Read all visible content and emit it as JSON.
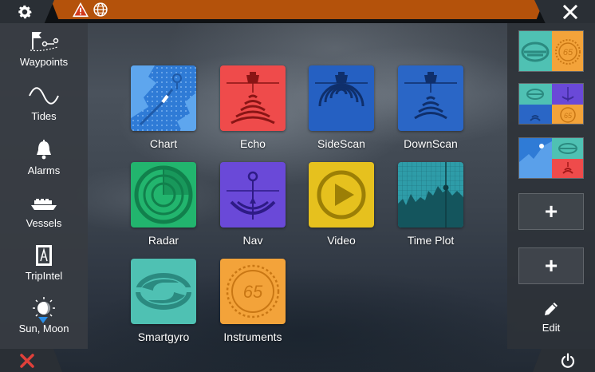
{
  "topbar": {
    "settings_icon": "gear-icon",
    "warning_icon": "warning-triangle-icon",
    "globe_icon": "globe-icon",
    "close_icon": "close-icon",
    "status_color": "#b4520b"
  },
  "sidebar": {
    "items": [
      {
        "label": "Waypoints",
        "icon": "waypoints-icon"
      },
      {
        "label": "Tides",
        "icon": "tides-icon"
      },
      {
        "label": "Alarms",
        "icon": "alarm-bell-icon"
      },
      {
        "label": "Vessels",
        "icon": "vessel-icon"
      },
      {
        "label": "TripIntel",
        "icon": "tripintel-icon"
      },
      {
        "label": "Sun, Moon",
        "icon": "sun-moon-icon"
      }
    ]
  },
  "apps": [
    {
      "label": "Chart",
      "icon": "chart-icon",
      "color": "#2f7bd6"
    },
    {
      "label": "Echo",
      "icon": "echo-icon",
      "color": "#ef4b4b"
    },
    {
      "label": "SideScan",
      "icon": "sidescan-icon",
      "color": "#2560c2"
    },
    {
      "label": "DownScan",
      "icon": "downscan-icon",
      "color": "#2a66c6"
    },
    {
      "label": "Radar",
      "icon": "radar-icon",
      "color": "#22b56e"
    },
    {
      "label": "Nav",
      "icon": "nav-icon",
      "color": "#6a49d8"
    },
    {
      "label": "Video",
      "icon": "video-play-icon",
      "color": "#e6c11e"
    },
    {
      "label": "Time Plot",
      "icon": "time-plot-icon",
      "color": "#2e9ca8"
    },
    {
      "label": "Smartgyro",
      "icon": "smartgyro-icon",
      "color": "#4fc1b3"
    },
    {
      "label": "Instruments",
      "icon": "instruments-icon",
      "color": "#f3a33a",
      "value": "65"
    }
  ],
  "favorites": {
    "tiles": [
      {
        "name": "favorite-smartgyro-instruments",
        "instrument_value": "65"
      },
      {
        "name": "favorite-four-panel",
        "instrument_value": "65"
      },
      {
        "name": "favorite-chart-smartgyro-echo"
      }
    ],
    "add_label": "+",
    "edit_label": "Edit"
  },
  "bottom": {
    "close_icon": "red-x-icon",
    "power_icon": "power-icon"
  }
}
